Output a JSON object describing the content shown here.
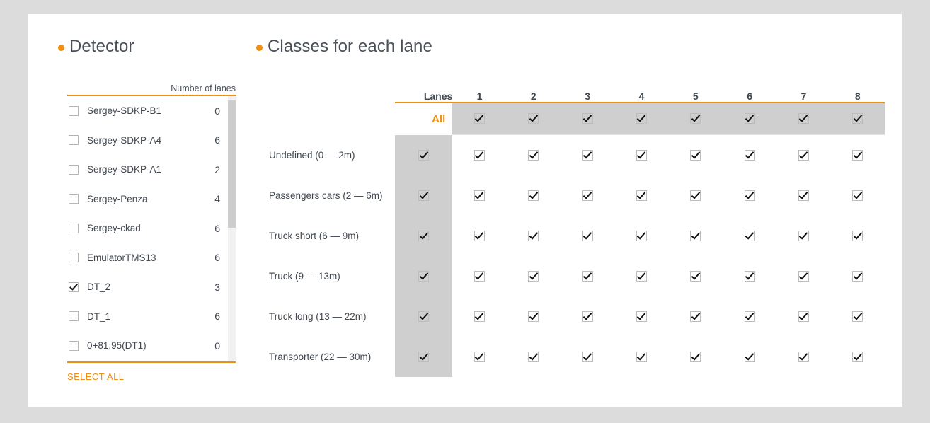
{
  "detector": {
    "title": "Detector",
    "column_header": "Number of lanes",
    "select_all_label": "SELECT ALL",
    "rows": [
      {
        "name": "0+81,95(DT1)",
        "lanes": "0",
        "checked": false
      },
      {
        "name": "DT_1",
        "lanes": "6",
        "checked": false
      },
      {
        "name": "DT_2",
        "lanes": "3",
        "checked": true
      },
      {
        "name": "EmulatorTMS13",
        "lanes": "6",
        "checked": false
      },
      {
        "name": "Sergey-ckad",
        "lanes": "6",
        "checked": false
      },
      {
        "name": "Sergey-Penza",
        "lanes": "4",
        "checked": false
      },
      {
        "name": "Sergey-SDKP-A1",
        "lanes": "2",
        "checked": false
      },
      {
        "name": "Sergey-SDKP-A4",
        "lanes": "6",
        "checked": false
      },
      {
        "name": "Sergey-SDKP-B1",
        "lanes": "0",
        "checked": false
      }
    ]
  },
  "classes": {
    "title": "Classes for each lane",
    "lanes_header": "Lanes",
    "all_label": "All",
    "lane_numbers": [
      "1",
      "2",
      "3",
      "4",
      "5",
      "6",
      "7",
      "8"
    ],
    "all_row_checked": [
      true,
      true,
      true,
      true,
      true,
      true,
      true,
      true
    ],
    "rows": [
      {
        "label": "Undefined (0 — 2m)",
        "all": true,
        "lanes": [
          true,
          true,
          true,
          true,
          true,
          true,
          true,
          true
        ]
      },
      {
        "label": "Passengers cars (2 — 6m)",
        "all": true,
        "lanes": [
          true,
          true,
          true,
          true,
          true,
          true,
          true,
          true
        ]
      },
      {
        "label": "Truck short (6 — 9m)",
        "all": true,
        "lanes": [
          true,
          true,
          true,
          true,
          true,
          true,
          true,
          true
        ]
      },
      {
        "label": "Truck (9 — 13m)",
        "all": true,
        "lanes": [
          true,
          true,
          true,
          true,
          true,
          true,
          true,
          true
        ]
      },
      {
        "label": "Truck long (13 — 22m)",
        "all": true,
        "lanes": [
          true,
          true,
          true,
          true,
          true,
          true,
          true,
          true
        ]
      },
      {
        "label": "Transporter (22 — 30m)",
        "all": true,
        "lanes": [
          true,
          true,
          true,
          true,
          true,
          true,
          true,
          true
        ]
      }
    ]
  },
  "colors": {
    "accent": "#ef8f13",
    "page_background": "#dcdcdc",
    "card_background": "#ffffff",
    "grey_column": "#cfcfcf",
    "text": "#40474f"
  }
}
